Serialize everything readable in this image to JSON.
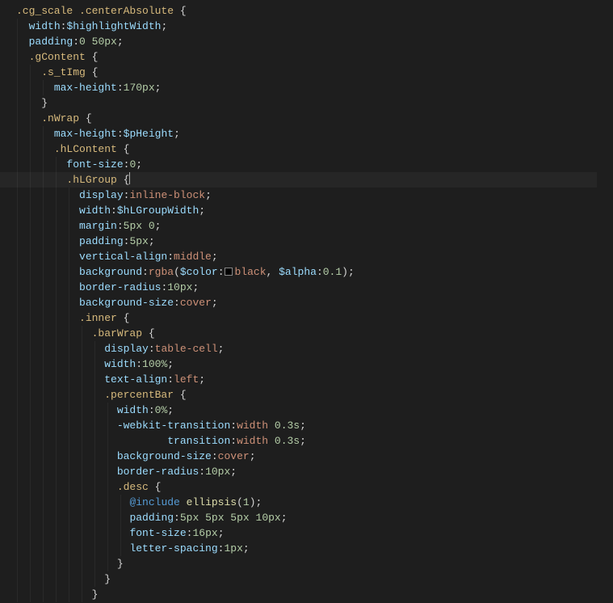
{
  "code_lines": [
    {
      "indent": 0,
      "tokens": [
        {
          "t": ".cg_scale ",
          "c": "t-sel"
        },
        {
          "t": ".centerAbsolute ",
          "c": "t-sel"
        },
        {
          "t": "{",
          "c": "t-punc"
        }
      ]
    },
    {
      "indent": 1,
      "tokens": [
        {
          "t": "width",
          "c": "t-prop"
        },
        {
          "t": ":",
          "c": "t-colon"
        },
        {
          "t": "$highlightWidth",
          "c": "t-var"
        },
        {
          "t": ";",
          "c": "t-punc"
        }
      ]
    },
    {
      "indent": 1,
      "tokens": [
        {
          "t": "padding",
          "c": "t-prop"
        },
        {
          "t": ":",
          "c": "t-colon"
        },
        {
          "t": "0 ",
          "c": "t-num"
        },
        {
          "t": "50",
          "c": "t-num"
        },
        {
          "t": "px",
          "c": "t-unit"
        },
        {
          "t": ";",
          "c": "t-punc"
        }
      ]
    },
    {
      "indent": 1,
      "tokens": [
        {
          "t": ".gContent ",
          "c": "t-sel"
        },
        {
          "t": "{",
          "c": "t-punc"
        }
      ]
    },
    {
      "indent": 2,
      "tokens": [
        {
          "t": ".s_tImg ",
          "c": "t-sel"
        },
        {
          "t": "{",
          "c": "t-punc"
        }
      ]
    },
    {
      "indent": 3,
      "tokens": [
        {
          "t": "max-height",
          "c": "t-prop"
        },
        {
          "t": ":",
          "c": "t-colon"
        },
        {
          "t": "170",
          "c": "t-num"
        },
        {
          "t": "px",
          "c": "t-unit"
        },
        {
          "t": ";",
          "c": "t-punc"
        }
      ]
    },
    {
      "indent": 2,
      "tokens": [
        {
          "t": "}",
          "c": "t-punc"
        }
      ]
    },
    {
      "indent": 2,
      "tokens": [
        {
          "t": ".nWrap ",
          "c": "t-sel"
        },
        {
          "t": "{",
          "c": "t-punc"
        }
      ]
    },
    {
      "indent": 3,
      "tokens": [
        {
          "t": "max-height",
          "c": "t-prop"
        },
        {
          "t": ":",
          "c": "t-colon"
        },
        {
          "t": "$pHeight",
          "c": "t-var"
        },
        {
          "t": ";",
          "c": "t-punc"
        }
      ]
    },
    {
      "indent": 3,
      "tokens": [
        {
          "t": ".hLContent ",
          "c": "t-sel"
        },
        {
          "t": "{",
          "c": "t-punc"
        }
      ]
    },
    {
      "indent": 4,
      "tokens": [
        {
          "t": "font-size",
          "c": "t-prop"
        },
        {
          "t": ":",
          "c": "t-colon"
        },
        {
          "t": "0",
          "c": "t-num"
        },
        {
          "t": ";",
          "c": "t-punc"
        }
      ]
    },
    {
      "indent": 4,
      "highlight": true,
      "tokens": [
        {
          "t": ".hLGroup ",
          "c": "t-sel"
        },
        {
          "t": "{",
          "c": "t-punc"
        },
        {
          "caret": true
        }
      ]
    },
    {
      "indent": 5,
      "tokens": [
        {
          "t": "display",
          "c": "t-prop"
        },
        {
          "t": ":",
          "c": "t-colon"
        },
        {
          "t": "inline-block",
          "c": "t-val"
        },
        {
          "t": ";",
          "c": "t-punc"
        }
      ]
    },
    {
      "indent": 5,
      "tokens": [
        {
          "t": "width",
          "c": "t-prop"
        },
        {
          "t": ":",
          "c": "t-colon"
        },
        {
          "t": "$hLGroupWidth",
          "c": "t-var"
        },
        {
          "t": ";",
          "c": "t-punc"
        }
      ]
    },
    {
      "indent": 5,
      "tokens": [
        {
          "t": "margin",
          "c": "t-prop"
        },
        {
          "t": ":",
          "c": "t-colon"
        },
        {
          "t": "5",
          "c": "t-num"
        },
        {
          "t": "px ",
          "c": "t-unit"
        },
        {
          "t": "0",
          "c": "t-num"
        },
        {
          "t": ";",
          "c": "t-punc"
        }
      ]
    },
    {
      "indent": 5,
      "tokens": [
        {
          "t": "padding",
          "c": "t-prop"
        },
        {
          "t": ":",
          "c": "t-colon"
        },
        {
          "t": "5",
          "c": "t-num"
        },
        {
          "t": "px",
          "c": "t-unit"
        },
        {
          "t": ";",
          "c": "t-punc"
        }
      ]
    },
    {
      "indent": 5,
      "tokens": [
        {
          "t": "vertical-align",
          "c": "t-prop"
        },
        {
          "t": ":",
          "c": "t-colon"
        },
        {
          "t": "middle",
          "c": "t-val"
        },
        {
          "t": ";",
          "c": "t-punc"
        }
      ]
    },
    {
      "indent": 5,
      "tokens": [
        {
          "t": "background",
          "c": "t-prop"
        },
        {
          "t": ":",
          "c": "t-colon"
        },
        {
          "t": "rgba",
          "c": "t-func"
        },
        {
          "t": "(",
          "c": "t-punc"
        },
        {
          "t": "$color",
          "c": "t-var"
        },
        {
          "t": ":",
          "c": "t-colon"
        },
        {
          "swatch": true
        },
        {
          "t": "black",
          "c": "t-val"
        },
        {
          "t": ", ",
          "c": "t-punc"
        },
        {
          "t": "$alpha",
          "c": "t-var"
        },
        {
          "t": ":",
          "c": "t-colon"
        },
        {
          "t": "0.1",
          "c": "t-num"
        },
        {
          "t": ")",
          "c": "t-punc"
        },
        {
          "t": ";",
          "c": "t-punc"
        }
      ]
    },
    {
      "indent": 5,
      "tokens": [
        {
          "t": "border-radius",
          "c": "t-prop"
        },
        {
          "t": ":",
          "c": "t-colon"
        },
        {
          "t": "10",
          "c": "t-num"
        },
        {
          "t": "px",
          "c": "t-unit"
        },
        {
          "t": ";",
          "c": "t-punc"
        }
      ]
    },
    {
      "indent": 5,
      "tokens": [
        {
          "t": "background-size",
          "c": "t-prop"
        },
        {
          "t": ":",
          "c": "t-colon"
        },
        {
          "t": "cover",
          "c": "t-val"
        },
        {
          "t": ";",
          "c": "t-punc"
        }
      ]
    },
    {
      "indent": 5,
      "tokens": [
        {
          "t": ".inner ",
          "c": "t-sel"
        },
        {
          "t": "{",
          "c": "t-punc"
        }
      ]
    },
    {
      "indent": 6,
      "tokens": [
        {
          "t": ".barWrap ",
          "c": "t-sel"
        },
        {
          "t": "{",
          "c": "t-punc"
        }
      ]
    },
    {
      "indent": 7,
      "tokens": [
        {
          "t": "display",
          "c": "t-prop"
        },
        {
          "t": ":",
          "c": "t-colon"
        },
        {
          "t": "table-cell",
          "c": "t-val"
        },
        {
          "t": ";",
          "c": "t-punc"
        }
      ]
    },
    {
      "indent": 7,
      "tokens": [
        {
          "t": "width",
          "c": "t-prop"
        },
        {
          "t": ":",
          "c": "t-colon"
        },
        {
          "t": "100",
          "c": "t-num"
        },
        {
          "t": "%",
          "c": "t-unit"
        },
        {
          "t": ";",
          "c": "t-punc"
        }
      ]
    },
    {
      "indent": 7,
      "tokens": [
        {
          "t": "text-align",
          "c": "t-prop"
        },
        {
          "t": ":",
          "c": "t-colon"
        },
        {
          "t": "left",
          "c": "t-val"
        },
        {
          "t": ";",
          "c": "t-punc"
        }
      ]
    },
    {
      "indent": 7,
      "tokens": [
        {
          "t": ".percentBar ",
          "c": "t-sel"
        },
        {
          "t": "{",
          "c": "t-punc"
        }
      ]
    },
    {
      "indent": 8,
      "tokens": [
        {
          "t": "width",
          "c": "t-prop"
        },
        {
          "t": ":",
          "c": "t-colon"
        },
        {
          "t": "0",
          "c": "t-num"
        },
        {
          "t": "%",
          "c": "t-unit"
        },
        {
          "t": ";",
          "c": "t-punc"
        }
      ]
    },
    {
      "indent": 8,
      "tokens": [
        {
          "t": "-webkit-transition",
          "c": "t-prop"
        },
        {
          "t": ":",
          "c": "t-colon"
        },
        {
          "t": "width ",
          "c": "t-val"
        },
        {
          "t": "0.3",
          "c": "t-num"
        },
        {
          "t": "s",
          "c": "t-unit"
        },
        {
          "t": ";",
          "c": "t-punc"
        }
      ]
    },
    {
      "indent": 8,
      "tokens": [
        {
          "t": "        transition",
          "c": "t-prop"
        },
        {
          "t": ":",
          "c": "t-colon"
        },
        {
          "t": "width ",
          "c": "t-val"
        },
        {
          "t": "0.3",
          "c": "t-num"
        },
        {
          "t": "s",
          "c": "t-unit"
        },
        {
          "t": ";",
          "c": "t-punc"
        }
      ]
    },
    {
      "indent": 8,
      "tokens": [
        {
          "t": "background-size",
          "c": "t-prop"
        },
        {
          "t": ":",
          "c": "t-colon"
        },
        {
          "t": "cover",
          "c": "t-val"
        },
        {
          "t": ";",
          "c": "t-punc"
        }
      ]
    },
    {
      "indent": 8,
      "tokens": [
        {
          "t": "border-radius",
          "c": "t-prop"
        },
        {
          "t": ":",
          "c": "t-colon"
        },
        {
          "t": "10",
          "c": "t-num"
        },
        {
          "t": "px",
          "c": "t-unit"
        },
        {
          "t": ";",
          "c": "t-punc"
        }
      ]
    },
    {
      "indent": 8,
      "tokens": [
        {
          "t": ".desc ",
          "c": "t-sel"
        },
        {
          "t": "{",
          "c": "t-punc"
        }
      ]
    },
    {
      "indent": 9,
      "tokens": [
        {
          "t": "@include",
          "c": "t-kw"
        },
        {
          "t": " ",
          "c": "t-punc"
        },
        {
          "t": "ellipsis",
          "c": "t-mix"
        },
        {
          "t": "(",
          "c": "t-punc"
        },
        {
          "t": "1",
          "c": "t-num"
        },
        {
          "t": ")",
          "c": "t-punc"
        },
        {
          "t": ";",
          "c": "t-punc"
        }
      ]
    },
    {
      "indent": 9,
      "tokens": [
        {
          "t": "padding",
          "c": "t-prop"
        },
        {
          "t": ":",
          "c": "t-colon"
        },
        {
          "t": "5",
          "c": "t-num"
        },
        {
          "t": "px ",
          "c": "t-unit"
        },
        {
          "t": "5",
          "c": "t-num"
        },
        {
          "t": "px ",
          "c": "t-unit"
        },
        {
          "t": "5",
          "c": "t-num"
        },
        {
          "t": "px ",
          "c": "t-unit"
        },
        {
          "t": "10",
          "c": "t-num"
        },
        {
          "t": "px",
          "c": "t-unit"
        },
        {
          "t": ";",
          "c": "t-punc"
        }
      ]
    },
    {
      "indent": 9,
      "tokens": [
        {
          "t": "font-size",
          "c": "t-prop"
        },
        {
          "t": ":",
          "c": "t-colon"
        },
        {
          "t": "16",
          "c": "t-num"
        },
        {
          "t": "px",
          "c": "t-unit"
        },
        {
          "t": ";",
          "c": "t-punc"
        }
      ]
    },
    {
      "indent": 9,
      "tokens": [
        {
          "t": "letter-spacing",
          "c": "t-prop"
        },
        {
          "t": ":",
          "c": "t-colon"
        },
        {
          "t": "1",
          "c": "t-num"
        },
        {
          "t": "px",
          "c": "t-unit"
        },
        {
          "t": ";",
          "c": "t-punc"
        }
      ]
    },
    {
      "indent": 8,
      "tokens": [
        {
          "t": "}",
          "c": "t-punc"
        }
      ]
    },
    {
      "indent": 7,
      "tokens": [
        {
          "t": "}",
          "c": "t-punc"
        }
      ]
    },
    {
      "indent": 6,
      "tokens": [
        {
          "t": "}",
          "c": "t-punc"
        }
      ]
    }
  ]
}
